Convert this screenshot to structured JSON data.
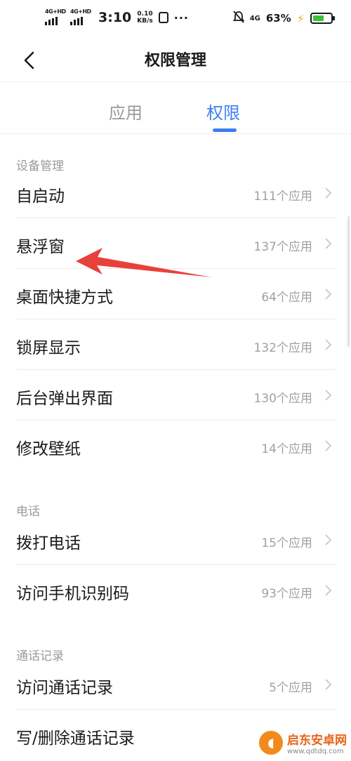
{
  "status_bar": {
    "sim1_tag": "4G+HD",
    "sim2_tag": "4G+HD",
    "time": "3:10",
    "speed_value": "0.10",
    "speed_unit": "KB/s",
    "more": "···",
    "network": "4G",
    "battery_percent": "63%",
    "battery_level": 0.63,
    "battery_color": "#38c238",
    "charging_color": "#f3b400"
  },
  "header": {
    "back_icon": "chevron-left-icon",
    "title": "权限管理"
  },
  "tabs": [
    {
      "label": "应用",
      "active": false
    },
    {
      "label": "权限",
      "active": true
    }
  ],
  "accent_color": "#3d7ff0",
  "annotation_color": "#e8413a",
  "sections": [
    {
      "title": "设备管理",
      "items": [
        {
          "label": "自启动",
          "count": "111个应用"
        },
        {
          "label": "悬浮窗",
          "count": "137个应用"
        },
        {
          "label": "桌面快捷方式",
          "count": "64个应用"
        },
        {
          "label": "锁屏显示",
          "count": "132个应用"
        },
        {
          "label": "后台弹出界面",
          "count": "130个应用"
        },
        {
          "label": "修改壁纸",
          "count": "14个应用"
        }
      ]
    },
    {
      "title": "电话",
      "items": [
        {
          "label": "拨打电话",
          "count": "15个应用"
        },
        {
          "label": "访问手机识别码",
          "count": "93个应用"
        }
      ]
    },
    {
      "title": "通话记录",
      "items": [
        {
          "label": "访问通话记录",
          "count": "5个应用"
        },
        {
          "label": "写/删除通话记录",
          "count": ""
        }
      ]
    }
  ],
  "watermark": {
    "name": "启东安卓网",
    "url": "www.qdtdq.com"
  }
}
